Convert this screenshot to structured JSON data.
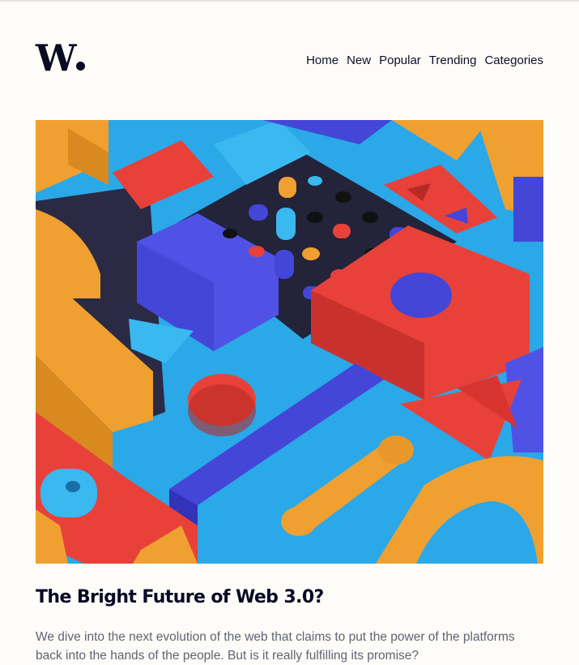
{
  "site": {
    "logo_text": "W"
  },
  "nav": {
    "items": [
      "Home",
      "New",
      "Popular",
      "Trending",
      "Categories"
    ]
  },
  "hero": {
    "icon": "abstract-3d-blocks-illustration"
  },
  "article": {
    "title": "The Bright Future of Web 3.0?",
    "excerpt": "We dive into the next evolution of the web that claims to put the power of the platforms back into the hands of the people. But is it really fulfilling its promise?"
  },
  "colors": {
    "background": "#fdfcf8",
    "text_dark": "#0d0f2b",
    "text_muted": "#5f6473",
    "orange": "#f0a030",
    "red": "#e8413a",
    "blue": "#4446d8",
    "sky": "#2aa8e8",
    "navy": "#23233a"
  }
}
